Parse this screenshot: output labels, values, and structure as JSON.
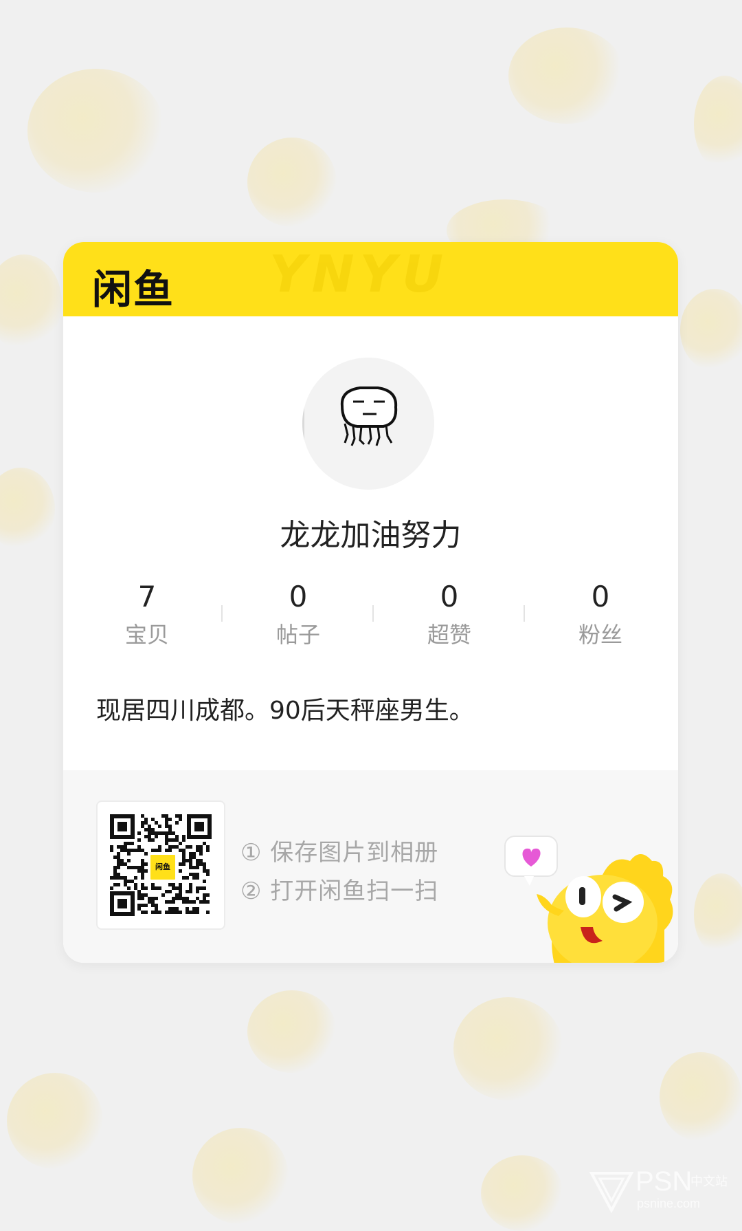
{
  "brand": {
    "logo_text": "闲鱼",
    "header_watermark": "YNYU"
  },
  "profile": {
    "nickname": "龙龙加油努力",
    "bio": "现居四川成都。90后天秤座男生。",
    "avatar_icon": "meme-face-avatar"
  },
  "stats": [
    {
      "value": "7",
      "label": "宝贝"
    },
    {
      "value": "0",
      "label": "帖子"
    },
    {
      "value": "0",
      "label": "超赞"
    },
    {
      "value": "0",
      "label": "粉丝"
    }
  ],
  "share": {
    "qr_center_label": "闲鱼",
    "steps": [
      "① 保存图片到相册",
      "② 打开闲鱼扫一扫"
    ],
    "mascot_icon": "yellow-fish-mascot-icon",
    "bubble_icon": "heart-bubble-icon"
  },
  "watermark": {
    "main": "PSN",
    "suffix": "中文站",
    "domain": "psnine.com"
  },
  "colors": {
    "brand_yellow": "#ffe019",
    "text_dark": "#222222",
    "text_muted": "#9a9a9a"
  }
}
